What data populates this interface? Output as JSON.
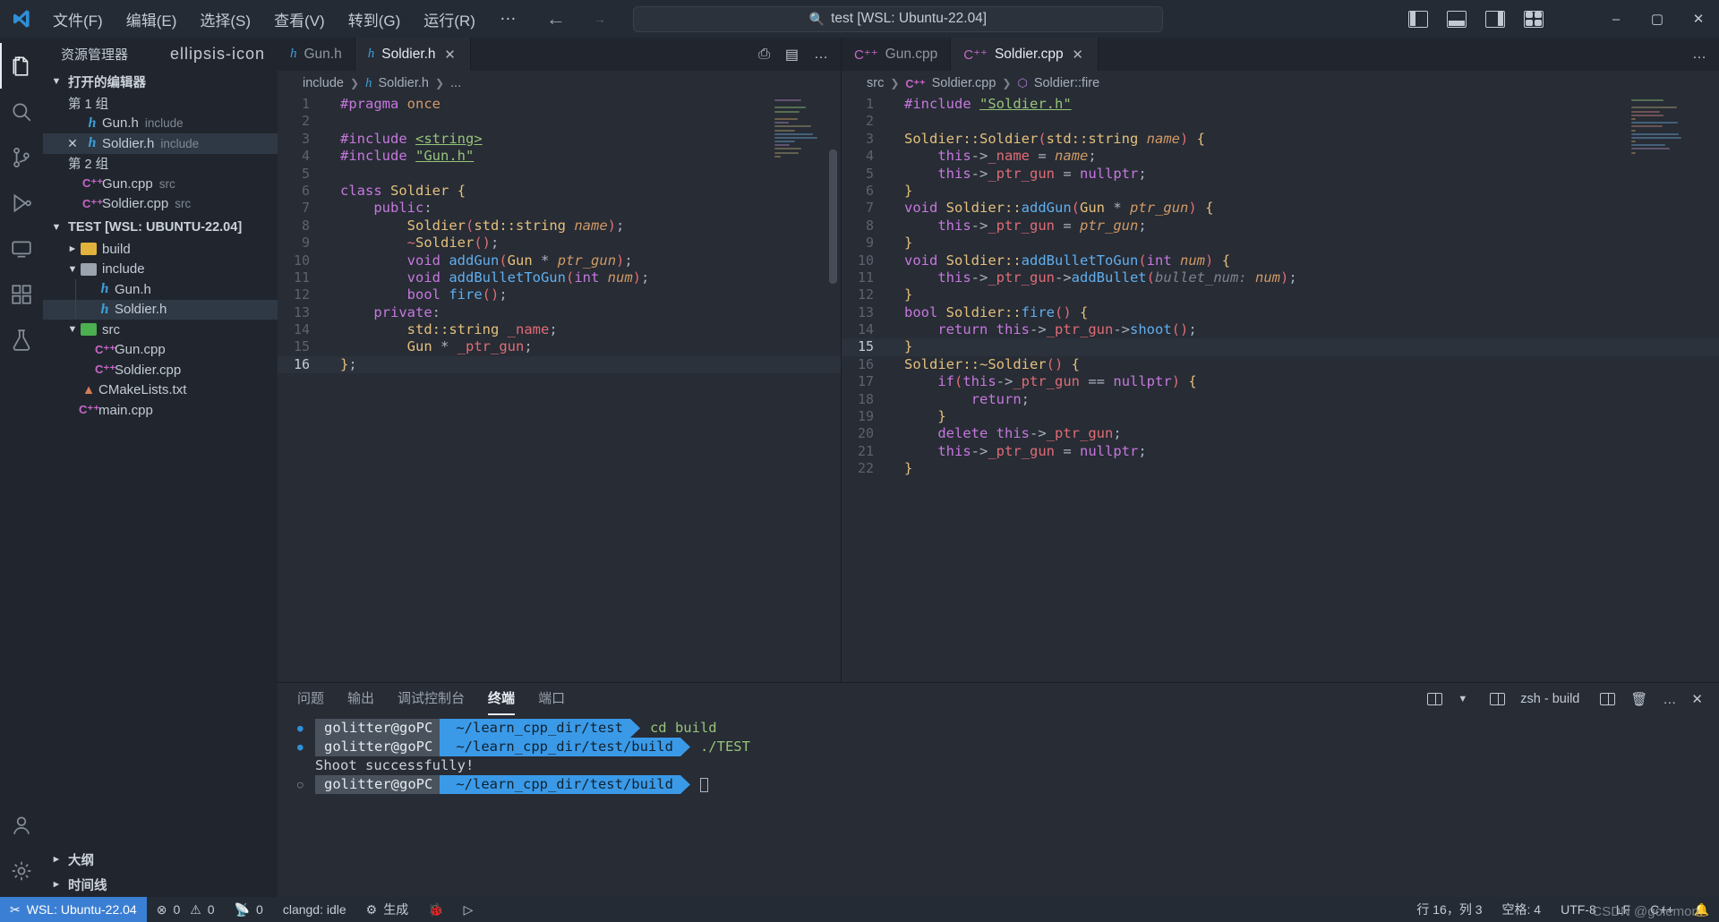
{
  "titlebar": {
    "menus": [
      "文件(F)",
      "编辑(E)",
      "选择(S)",
      "查看(V)",
      "转到(G)",
      "运行(R)"
    ],
    "more": "…",
    "back_icon": "arrow-left-icon",
    "forward_icon": "arrow-right-icon",
    "search_placeholder": "test [WSL: Ubuntu-22.04]",
    "search_icon": "search-icon",
    "minimize": "–",
    "maximize": "▢",
    "close": "✕"
  },
  "activitybar": {
    "items": [
      {
        "name": "explorer",
        "icon": "files-icon",
        "active": true
      },
      {
        "name": "search",
        "icon": "search-icon",
        "active": false
      },
      {
        "name": "source-control",
        "icon": "source-control-icon",
        "active": false
      },
      {
        "name": "run-debug",
        "icon": "run-debug-icon",
        "active": false
      },
      {
        "name": "remote-explorer",
        "icon": "remote-explorer-icon",
        "active": false
      },
      {
        "name": "extensions",
        "icon": "extensions-icon",
        "active": false
      },
      {
        "name": "testing",
        "icon": "beaker-icon",
        "active": false
      }
    ],
    "bottom": [
      {
        "name": "accounts",
        "icon": "account-icon"
      },
      {
        "name": "settings",
        "icon": "gear-icon"
      }
    ]
  },
  "sidebar": {
    "title": "资源管理器",
    "more_icon": "ellipsis-icon",
    "open_editors": {
      "label": "打开的编辑器",
      "groups": [
        {
          "label": "第 1 组",
          "items": [
            {
              "icon": "h-file-icon",
              "name": "Gun.h",
              "folder": "include",
              "selected": false,
              "dirty": false
            },
            {
              "icon": "h-file-icon",
              "name": "Soldier.h",
              "folder": "include",
              "selected": true,
              "dirty": true
            }
          ]
        },
        {
          "label": "第 2 组",
          "items": [
            {
              "icon": "cpp-file-icon",
              "name": "Gun.cpp",
              "folder": "src",
              "selected": false,
              "dirty": false
            },
            {
              "icon": "cpp-file-icon",
              "name": "Soldier.cpp",
              "folder": "src",
              "selected": false,
              "dirty": false
            }
          ]
        }
      ]
    },
    "workspace": {
      "label": "TEST [WSL: UBUNTU-22.04]",
      "tree": [
        {
          "type": "folder",
          "name": "build",
          "expanded": false,
          "depth": 1
        },
        {
          "type": "folder",
          "name": "include",
          "expanded": true,
          "depth": 1
        },
        {
          "type": "file",
          "icon": "h-file-icon",
          "name": "Gun.h",
          "depth": 2,
          "selected": false
        },
        {
          "type": "file",
          "icon": "h-file-icon",
          "name": "Soldier.h",
          "depth": 2,
          "selected": true
        },
        {
          "type": "folder",
          "name": "src",
          "expanded": true,
          "depth": 1
        },
        {
          "type": "file",
          "icon": "cpp-file-icon",
          "name": "Gun.cpp",
          "depth": 2,
          "selected": false
        },
        {
          "type": "file",
          "icon": "cpp-file-icon",
          "name": "Soldier.cpp",
          "depth": 2,
          "selected": false
        },
        {
          "type": "file",
          "icon": "cmake-file-icon",
          "name": "CMakeLists.txt",
          "depth": 1,
          "selected": false
        },
        {
          "type": "file",
          "icon": "cpp-file-icon",
          "name": "main.cpp",
          "depth": 1,
          "selected": false
        }
      ]
    },
    "outline": "大纲",
    "timeline": "时间线"
  },
  "editor_left": {
    "tabs": [
      {
        "icon": "h-file-icon",
        "label": "Gun.h",
        "active": false,
        "closable": false
      },
      {
        "icon": "h-file-icon",
        "label": "Soldier.h",
        "active": true,
        "closable": true
      }
    ],
    "actions": [
      "run-build-icon",
      "split-editor-icon",
      "more-actions-icon"
    ],
    "breadcrumb": [
      "include",
      "Soldier.h",
      "..."
    ],
    "lines": [
      {
        "n": 1,
        "text": "#pragma once"
      },
      {
        "n": 2,
        "text": ""
      },
      {
        "n": 3,
        "text": "#include <string>"
      },
      {
        "n": 4,
        "text": "#include \"Gun.h\""
      },
      {
        "n": 5,
        "text": ""
      },
      {
        "n": 6,
        "text": "class Soldier {"
      },
      {
        "n": 7,
        "text": "    public:"
      },
      {
        "n": 8,
        "text": "        Soldier(std::string name);"
      },
      {
        "n": 9,
        "text": "        ~Soldier();"
      },
      {
        "n": 10,
        "text": "        void addGun(Gun * ptr_gun);"
      },
      {
        "n": 11,
        "text": "        void addBulletToGun(int num);"
      },
      {
        "n": 12,
        "text": "        bool fire();"
      },
      {
        "n": 13,
        "text": "    private:"
      },
      {
        "n": 14,
        "text": "        std::string _name;"
      },
      {
        "n": 15,
        "text": "        Gun * _ptr_gun;"
      },
      {
        "n": 16,
        "text": "};"
      }
    ],
    "current_line": 16
  },
  "editor_right": {
    "tabs": [
      {
        "icon": "cpp-file-icon",
        "label": "Gun.cpp",
        "active": false,
        "closable": false
      },
      {
        "icon": "cpp-file-icon",
        "label": "Soldier.cpp",
        "active": true,
        "closable": true
      }
    ],
    "actions": [
      "more-actions-icon"
    ],
    "breadcrumb": [
      "src",
      "Soldier.cpp",
      "Soldier::fire"
    ],
    "lines": [
      {
        "n": 1,
        "text": "#include \"Soldier.h\""
      },
      {
        "n": 2,
        "text": ""
      },
      {
        "n": 3,
        "text": "Soldier::Soldier(std::string name) {"
      },
      {
        "n": 4,
        "text": "    this->_name = name;"
      },
      {
        "n": 5,
        "text": "    this->_ptr_gun = nullptr;"
      },
      {
        "n": 6,
        "text": "}"
      },
      {
        "n": 7,
        "text": "void Soldier::addGun(Gun * ptr_gun) {"
      },
      {
        "n": 8,
        "text": "    this->_ptr_gun = ptr_gun;"
      },
      {
        "n": 9,
        "text": "}"
      },
      {
        "n": 10,
        "text": "void Soldier::addBulletToGun(int num) {"
      },
      {
        "n": 11,
        "text": "    this->_ptr_gun->addBullet(bullet_num: num);"
      },
      {
        "n": 12,
        "text": "}"
      },
      {
        "n": 13,
        "text": "bool Soldier::fire() {"
      },
      {
        "n": 14,
        "text": "    return this->_ptr_gun->shoot();"
      },
      {
        "n": 15,
        "text": "}"
      },
      {
        "n": 16,
        "text": "Soldier::~Soldier() {"
      },
      {
        "n": 17,
        "text": "    if(this->_ptr_gun == nullptr) {"
      },
      {
        "n": 18,
        "text": "        return;"
      },
      {
        "n": 19,
        "text": "    }"
      },
      {
        "n": 20,
        "text": "    delete this->_ptr_gun;"
      },
      {
        "n": 21,
        "text": "    this->_ptr_gun = nullptr;"
      },
      {
        "n": 22,
        "text": "}"
      }
    ],
    "current_line": 15
  },
  "panel": {
    "tabs": [
      {
        "label": "问题",
        "active": false
      },
      {
        "label": "输出",
        "active": false
      },
      {
        "label": "调试控制台",
        "active": false
      },
      {
        "label": "终端",
        "active": true
      },
      {
        "label": "端口",
        "active": false
      }
    ],
    "actions": {
      "split_icon": "split-terminal-icon",
      "chevron_icon": "chevron-down-icon",
      "terminal_name": "zsh - build",
      "terminal_icon": "terminal-icon",
      "split_panel_icon": "split-panel-icon",
      "trash_icon": "trash-icon",
      "more_icon": "ellipsis-icon",
      "close_icon": "close-icon"
    },
    "terminal_lines": [
      {
        "type": "prompt",
        "bullet": "filled",
        "user": "golitter@goPC",
        "path": "~/learn_cpp_dir/test",
        "command": "cd build"
      },
      {
        "type": "prompt",
        "bullet": "filled",
        "user": "golitter@goPC",
        "path": "~/learn_cpp_dir/test/build",
        "command": "./TEST"
      },
      {
        "type": "output",
        "text": "Shoot successfully!"
      },
      {
        "type": "prompt",
        "bullet": "hollow",
        "user": "golitter@goPC",
        "path": "~/learn_cpp_dir/test/build",
        "command": ""
      }
    ]
  },
  "statusbar": {
    "remote": "WSL: Ubuntu-22.04",
    "remote_icon": "remote-icon",
    "errors_icon": "error-icon",
    "errors": "0",
    "warnings_icon": "warning-icon",
    "warnings": "0",
    "ports_icon": "radio-tower-icon",
    "ports": "0",
    "clangd": "clangd: idle",
    "build_icon": "gear-icon",
    "build": "生成",
    "debug_icon": "bug-icon",
    "run_icon": "play-icon",
    "cursor_position": "行 16，列 3",
    "indentation": "空格: 4",
    "encoding": "UTF-8",
    "eol": "LF",
    "language": "C++",
    "bell_icon": "bell-icon",
    "watermark": "CSDN @golemon."
  },
  "colors": {
    "accent": "#3b7fd4",
    "terminal_path": "#3b9ae8",
    "titlebar_bg": "#252b34",
    "editor_bg": "#272c35",
    "sidebar_bg": "#21262e"
  }
}
